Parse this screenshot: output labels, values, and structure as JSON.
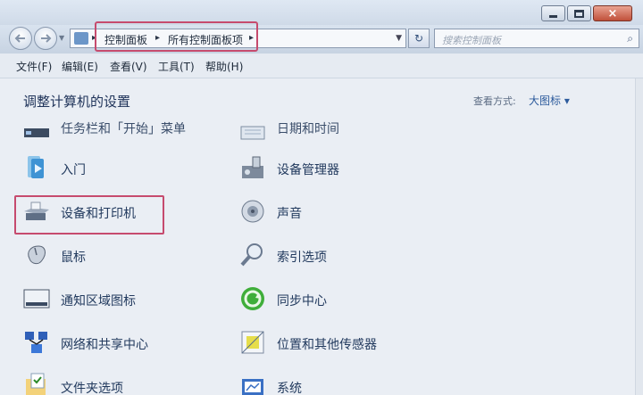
{
  "window": {
    "caption": {
      "minimize": "",
      "maximize": "",
      "close": "×"
    }
  },
  "nav": {
    "breadcrumb": [
      "控制面板",
      "所有控制面板项"
    ],
    "search_placeholder": "搜索控制面板",
    "refresh_icon": "↻",
    "search_icon": "⌕"
  },
  "menu": [
    "文件(F)",
    "编辑(E)",
    "查看(V)",
    "工具(T)",
    "帮助(H)"
  ],
  "page": {
    "title": "调整计算机的设置",
    "view_by_label": "查看方式:",
    "view_by_value": "大图标 ▾"
  },
  "items_left": [
    {
      "label": "任务栏和「开始」菜单",
      "icon": "taskbar-icon"
    },
    {
      "label": "入门",
      "icon": "getting-started-icon"
    },
    {
      "label": "设备和打印机",
      "icon": "printer-icon"
    },
    {
      "label": "鼠标",
      "icon": "mouse-icon"
    },
    {
      "label": "通知区域图标",
      "icon": "notification-area-icon"
    },
    {
      "label": "网络和共享中心",
      "icon": "network-icon"
    },
    {
      "label": "文件夹选项",
      "icon": "folder-options-icon"
    }
  ],
  "items_right": [
    {
      "label": "日期和时间",
      "icon": "calendar-icon"
    },
    {
      "label": "设备管理器",
      "icon": "device-manager-icon"
    },
    {
      "label": "声音",
      "icon": "speaker-icon"
    },
    {
      "label": "索引选项",
      "icon": "indexing-icon"
    },
    {
      "label": "同步中心",
      "icon": "sync-icon"
    },
    {
      "label": "位置和其他传感器",
      "icon": "location-sensor-icon"
    },
    {
      "label": "系统",
      "icon": "system-icon"
    }
  ]
}
